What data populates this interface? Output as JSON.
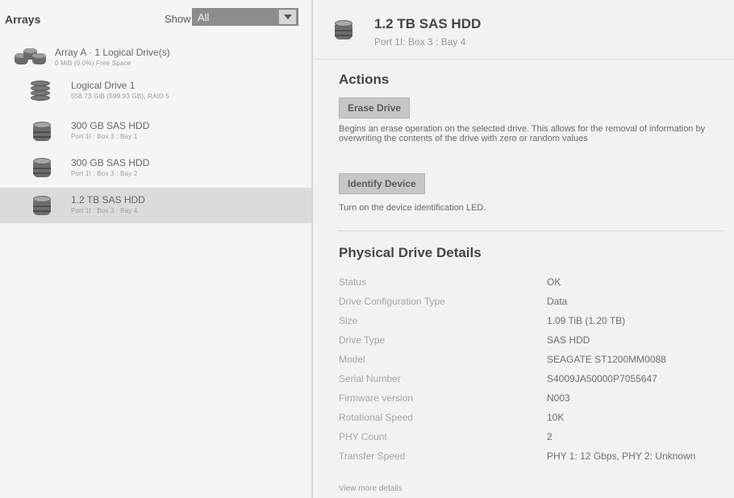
{
  "left": {
    "title": "Arrays",
    "show_label": "Show",
    "show_value": "All",
    "items": [
      {
        "title": "Array A · 1 Logical Drive(s)",
        "sub": "0 MiB (0.0%) Free Space"
      },
      {
        "title": "Logical Drive 1",
        "sub": "558.73 GiB (599.93 GB), RAID 5"
      },
      {
        "title": "300 GB SAS HDD",
        "sub": "Port 1I : Box 3 : Bay 1"
      },
      {
        "title": "300 GB SAS HDD",
        "sub": "Port 1I : Box 3 : Bay 2"
      },
      {
        "title": "1.2 TB SAS HDD",
        "sub": "Port 1I : Box 3 : Bay 4"
      }
    ]
  },
  "right": {
    "title": "1.2 TB SAS HDD",
    "subtitle": "Port 1I: Box 3 : Bay 4",
    "actions_title": "Actions",
    "erase_label": "Erase Drive",
    "erase_desc": "Begins an erase operation on the selected drive. This allows for the removal of information by overwriting the contents of the drive with zero or random values",
    "identify_label": "Identify Device",
    "identify_desc": "Turn on the device identification LED.",
    "details_title": "Physical Drive Details",
    "details": [
      {
        "label": "Status",
        "value": "OK"
      },
      {
        "label": "Drive Configuration Type",
        "value": "Data"
      },
      {
        "label": "Size",
        "value": "1.09 TiB (1.20 TB)"
      },
      {
        "label": "Drive Type",
        "value": "SAS HDD"
      },
      {
        "label": "Model",
        "value": "SEAGATE ST1200MM0088"
      },
      {
        "label": "Serial Number",
        "value": "S4009JA50000P7055647"
      },
      {
        "label": "Firmware version",
        "value": "N003"
      },
      {
        "label": "Rotational Speed",
        "value": "10K"
      },
      {
        "label": "PHY Count",
        "value": "2"
      },
      {
        "label": "Transfer Speed",
        "value": "PHY 1: 12 Gbps, PHY 2: Unknown"
      }
    ],
    "view_more": "View more details"
  },
  "colors": {
    "selected_row": "#dddada",
    "button_bg": "#c9c6c6",
    "select_bg": "#8f8c8c"
  },
  "icons": {
    "array": "array-icon",
    "logical_drive": "logical-drive-icon",
    "hdd": "hdd-icon",
    "dropdown": "chevron-down-icon"
  }
}
